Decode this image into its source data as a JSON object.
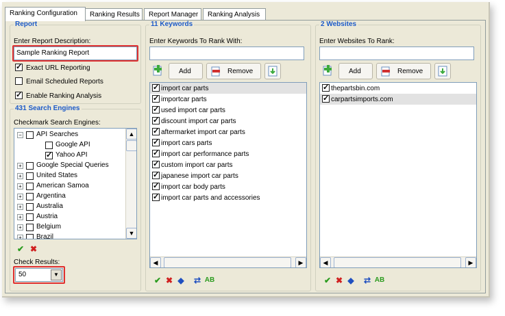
{
  "tabs": [
    "Ranking Configuration",
    "Ranking Results",
    "Report Manager",
    "Ranking Analysis"
  ],
  "report": {
    "title": "Report",
    "desc_label": "Enter Report Description:",
    "desc_value": "Sample Ranking Report",
    "options": [
      {
        "label": "Exact URL Reporting",
        "checked": true
      },
      {
        "label": "Email Scheduled Reports",
        "checked": false
      },
      {
        "label": "Enable Ranking Analysis",
        "checked": true
      }
    ]
  },
  "engines": {
    "title": "431 Search Engines",
    "label": "Checkmark Search Engines:",
    "tree": [
      {
        "label": "API Searches",
        "expand": "−",
        "checked": false,
        "level": 0
      },
      {
        "label": "Google API",
        "expand": "",
        "checked": false,
        "level": 1
      },
      {
        "label": "Yahoo API",
        "expand": "",
        "checked": true,
        "level": 1
      },
      {
        "label": "Google Special Queries",
        "expand": "+",
        "checked": false,
        "level": 0
      },
      {
        "label": "United States",
        "expand": "+",
        "checked": false,
        "level": 0
      },
      {
        "label": "American Samoa",
        "expand": "+",
        "checked": false,
        "level": 0
      },
      {
        "label": "Argentina",
        "expand": "+",
        "checked": false,
        "level": 0
      },
      {
        "label": "Australia",
        "expand": "+",
        "checked": false,
        "level": 0
      },
      {
        "label": "Austria",
        "expand": "+",
        "checked": false,
        "level": 0
      },
      {
        "label": "Belgium",
        "expand": "+",
        "checked": false,
        "level": 0
      },
      {
        "label": "Brazil",
        "expand": "+",
        "checked": false,
        "level": 0
      }
    ],
    "check_results_label": "Check Results:",
    "check_results_value": "50"
  },
  "keywords": {
    "title": "11 Keywords",
    "label": "Enter Keywords To Rank With:",
    "add_label": "Add",
    "remove_label": "Remove",
    "items": [
      "import car parts",
      "importcar parts",
      "used import car parts",
      "discount import car parts",
      "aftermarket import car parts",
      "import cars parts",
      "import car performance parts",
      "custom import car parts",
      "japanese import car parts",
      "import car body parts",
      "import car parts and accessories"
    ]
  },
  "websites": {
    "title": "2 Websites",
    "label": "Enter Websites To Rank:",
    "add_label": "Add",
    "remove_label": "Remove",
    "items": [
      "thepartsbin.com",
      "carpartsimports.com"
    ]
  },
  "colors": {
    "group_title": "#1c5ac8",
    "highlight": "#e03030",
    "accent_green": "#2a9b1e"
  }
}
